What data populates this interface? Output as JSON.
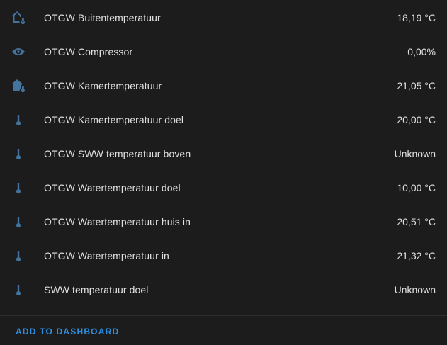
{
  "entities": [
    {
      "name": "OTGW Buitentemperatuur",
      "value": "18,19 °C",
      "icon": "home-thermometer-outline-icon"
    },
    {
      "name": "OTGW Compressor",
      "value": "0,00%",
      "icon": "eye-icon"
    },
    {
      "name": "OTGW Kamertemperatuur",
      "value": "21,05 °C",
      "icon": "home-thermometer-icon"
    },
    {
      "name": "OTGW Kamertemperatuur doel",
      "value": "20,00 °C",
      "icon": "thermometer-icon"
    },
    {
      "name": "OTGW SWW temperatuur boven",
      "value": "Unknown",
      "icon": "thermometer-icon"
    },
    {
      "name": "OTGW Watertemperatuur doel",
      "value": "10,00 °C",
      "icon": "thermometer-icon"
    },
    {
      "name": "OTGW Watertemperatuur huis in",
      "value": "20,51 °C",
      "icon": "thermometer-icon"
    },
    {
      "name": "OTGW Watertemperatuur in",
      "value": "21,32 °C",
      "icon": "thermometer-icon"
    },
    {
      "name": "SWW temperatuur doel",
      "value": "Unknown",
      "icon": "thermometer-icon"
    }
  ],
  "footer": {
    "add_to_dashboard_label": "ADD TO DASHBOARD"
  },
  "colors": {
    "icon": "#44739e",
    "accent": "#2f8fe0",
    "background": "#1c1c1c",
    "text": "#e1e1e1"
  }
}
